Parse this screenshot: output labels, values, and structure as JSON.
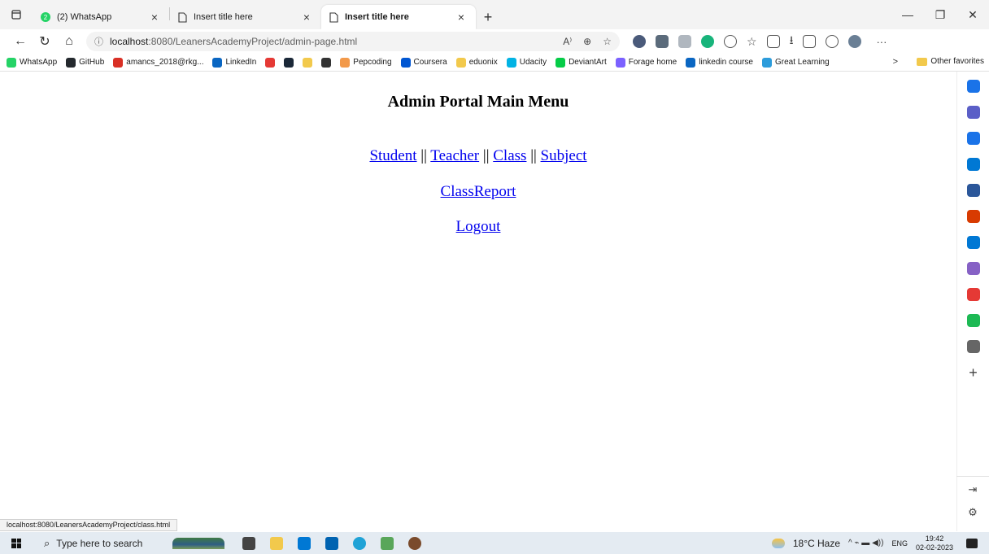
{
  "browser": {
    "tabs": [
      {
        "title": "(2) WhatsApp",
        "icon": "whatsapp-icon",
        "icon_color": "#25d366",
        "badge": "2",
        "close": "×"
      },
      {
        "title": "Insert title here",
        "icon": "page-icon",
        "close": "×"
      },
      {
        "title": "Insert title here",
        "icon": "page-icon",
        "close": "×",
        "active": true
      }
    ],
    "new_tab": "+",
    "window_controls": {
      "minimize": "—",
      "restore": "❐",
      "close": "✕"
    },
    "address": {
      "host": "localhost",
      "rest": ":8080/LeanersAcademyProject/admin-page.html",
      "read_aloud": "A⁾",
      "zoom": "⊕",
      "favorite": "☆"
    },
    "menu_dots": "···",
    "favorites": [
      {
        "label": "WhatsApp",
        "color": "#25d366"
      },
      {
        "label": "GitHub",
        "color": "#24292e"
      },
      {
        "label": "amancs_2018@rkg...",
        "color": "#d93025"
      },
      {
        "label": "LinkedIn",
        "color": "#0a66c2"
      },
      {
        "label": "",
        "color": "#e53935"
      },
      {
        "label": "",
        "color": "#1b2838"
      },
      {
        "label": "",
        "color": "#f2c94c"
      },
      {
        "label": "",
        "color": "#333333"
      },
      {
        "label": "Pepcoding",
        "color": "#f2994a"
      },
      {
        "label": "Coursera",
        "color": "#0056d2"
      },
      {
        "label": "eduonix",
        "color": "#f2c94c"
      },
      {
        "label": "Udacity",
        "color": "#02b3e4"
      },
      {
        "label": "DeviantArt",
        "color": "#05cc47"
      },
      {
        "label": "Forage home",
        "color": "#7b61ff"
      },
      {
        "label": "linkedin course",
        "color": "#0a66c2"
      },
      {
        "label": "Great Learning",
        "color": "#2d9cdb"
      }
    ],
    "favorites_more": ">",
    "other_favorites": "Other favorites",
    "status_url": "localhost:8080/LeanersAcademyProject/class.html"
  },
  "page": {
    "heading": "Admin Portal Main Menu",
    "links_row1": [
      {
        "label": "Student"
      },
      {
        "label": "Teacher"
      },
      {
        "label": "Class"
      },
      {
        "label": "Subject"
      }
    ],
    "separator": "||",
    "class_report": "ClassReport",
    "logout": "Logout"
  },
  "sidebar_icons": [
    {
      "name": "search-icon",
      "color": "#1a73e8"
    },
    {
      "name": "sparkle-icon",
      "color": "#5b5fc7"
    },
    {
      "name": "tag-icon",
      "color": "#1a73e8"
    },
    {
      "name": "briefcase-icon",
      "color": "#0078d4"
    },
    {
      "name": "games-icon",
      "color": "#2b579a"
    },
    {
      "name": "office-icon",
      "color": "#d83b01"
    },
    {
      "name": "outlook-icon",
      "color": "#0078d4"
    },
    {
      "name": "designer-icon",
      "color": "#8661c5"
    },
    {
      "name": "music-icon",
      "color": "#e53935"
    },
    {
      "name": "spotify-icon",
      "color": "#1db954"
    },
    {
      "name": "news-icon",
      "color": "#666666"
    }
  ],
  "taskbar": {
    "search_placeholder": "Type here to search",
    "apps": [
      {
        "name": "task-view-icon",
        "color": "#444444"
      },
      {
        "name": "file-explorer-icon",
        "color": "#f2c94c"
      },
      {
        "name": "store-icon",
        "color": "#0078d4"
      },
      {
        "name": "mail-icon",
        "color": "#0063b1"
      },
      {
        "name": "edge-icon",
        "color": "#1fa2d6"
      },
      {
        "name": "notes-icon",
        "color": "#59a65a"
      },
      {
        "name": "game-icon",
        "color": "#7a4b2c"
      }
    ],
    "weather": "18°C  Haze",
    "tray_symbols": "^  ⌁  ▬  ◀))",
    "language": "ENG",
    "time": "19:42",
    "date": "02-02-2023"
  }
}
